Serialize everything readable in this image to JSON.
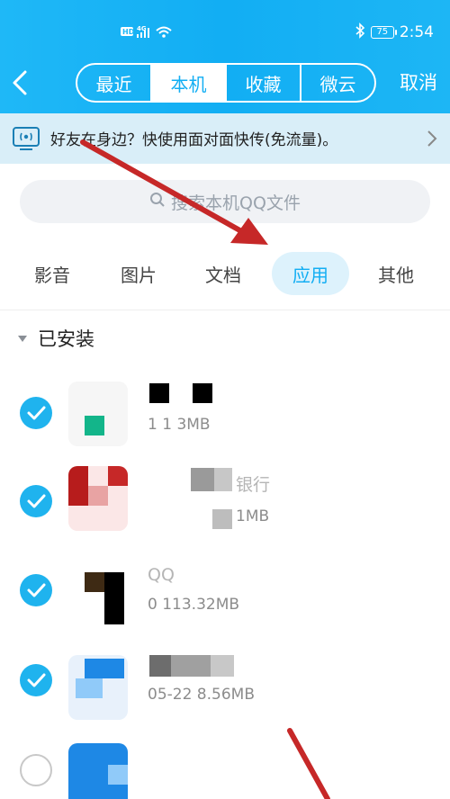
{
  "status_bar": {
    "network": "HD 4G",
    "battery": "75",
    "time": "2:54"
  },
  "nav": {
    "tabs": [
      {
        "label": "最近",
        "active": false
      },
      {
        "label": "本机",
        "active": true
      },
      {
        "label": "收藏",
        "active": false
      },
      {
        "label": "微云",
        "active": false
      }
    ],
    "cancel_label": "取消"
  },
  "banner": {
    "text": "好友在身边？快使用面对面快传(免流量)。"
  },
  "search": {
    "placeholder": "搜索本机QQ文件"
  },
  "categories": [
    {
      "label": "影音",
      "active": false
    },
    {
      "label": "图片",
      "active": false
    },
    {
      "label": "文档",
      "active": false
    },
    {
      "label": "应用",
      "active": true
    },
    {
      "label": "其他",
      "active": false
    }
  ],
  "section": {
    "title": "已安装"
  },
  "apps": [
    {
      "name": "",
      "meta": "1 1 3MB",
      "checked": true
    },
    {
      "name": "银行",
      "meta": "1MB",
      "checked": true
    },
    {
      "name": "QQ",
      "meta": "0  113.32MB",
      "checked": true
    },
    {
      "name": "",
      "meta": "05-22 8.56MB",
      "checked": true
    },
    {
      "name": "",
      "meta": "",
      "checked": false
    }
  ],
  "colors": {
    "accent": "#12aef3",
    "banner_bg": "#d9eef8",
    "annotation_arrow": "#c62828"
  }
}
